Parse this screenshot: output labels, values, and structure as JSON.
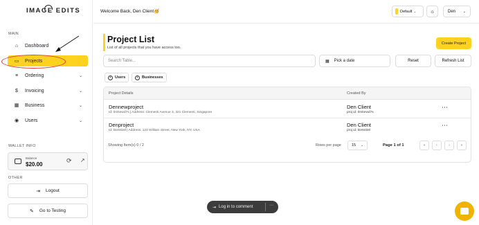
{
  "brand": {
    "logo_text": "IMAGE EDITS"
  },
  "sidebar": {
    "main_label": "MAIN",
    "items": [
      {
        "label": "Dashboard",
        "icon": "home-icon"
      },
      {
        "label": "Projects",
        "icon": "folder-icon",
        "active": true
      },
      {
        "label": "Ordering",
        "icon": "list-icon",
        "has_chevron": true
      },
      {
        "label": "Invoicing",
        "icon": "dollar-icon",
        "has_chevron": true
      },
      {
        "label": "Business",
        "icon": "building-icon",
        "has_chevron": true
      },
      {
        "label": "Users",
        "icon": "user-icon",
        "has_chevron": true
      }
    ],
    "wallet_label": "WALLET INFO",
    "wallet": {
      "balance_label": "Balance",
      "balance": "$20.00"
    },
    "other_label": "OTHER",
    "logout_label": "Logout",
    "testing_label": "Go to Testing"
  },
  "header": {
    "welcome": "Welcome Back, Den Client🥳",
    "theme_select": "Default",
    "user_select": "Den"
  },
  "page": {
    "title": "Project List",
    "subtitle": "List of all projects that you have access too.",
    "create_button": "Create Project",
    "search_placeholder": "Search Table...",
    "date_picker": "Pick a date",
    "reset_button": "Reset",
    "refresh_button": "Refresh List",
    "filter_users": "Users",
    "filter_businesses": "Businesses"
  },
  "table": {
    "columns": [
      "Project Details",
      "Created By"
    ],
    "rows": [
      {
        "name": "Dennewproject",
        "details": "Id: 0mkewd7s | Address: Clementi Avenue 3, 321 Clementi, Singapore",
        "creator": "Den Client",
        "creator_id": "proj id: 0mkewd7s"
      },
      {
        "name": "Denproject",
        "details": "Id: kte6nb8l | Address: 123 William Street, New York, NY, USA",
        "creator": "Den Client",
        "creator_id": "proj id: kte6nb8l"
      }
    ]
  },
  "pagination": {
    "showing": "Showing Item(s) 0 / 2",
    "rows_per_page_label": "Rows per page",
    "rows_per_page_value": "15",
    "page_of": "Page 1 of 1"
  },
  "comment_pill": {
    "label": "Log in to comment"
  },
  "colors": {
    "accent": "#ffd21f",
    "annotation": "#e53935",
    "chat": "#f0b400"
  }
}
